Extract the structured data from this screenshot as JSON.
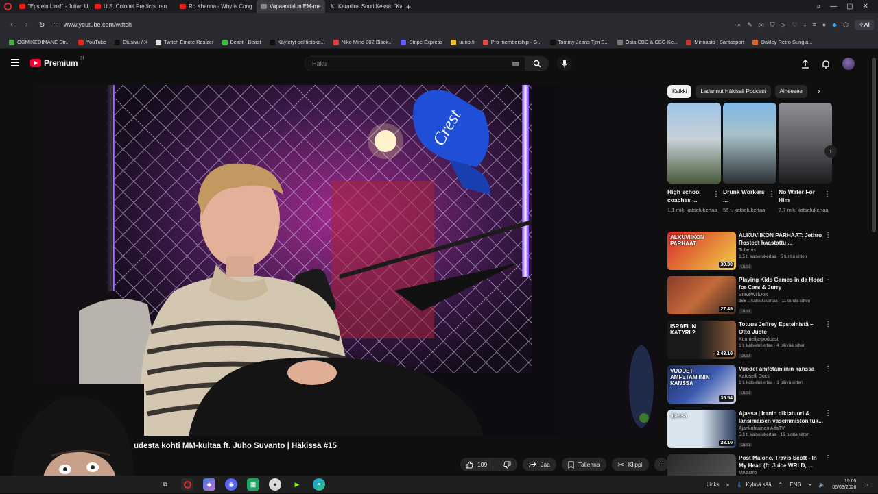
{
  "browser": {
    "tabs": [
      {
        "label": "\"Epstein Link!\" - Julian U..."
      },
      {
        "label": "U.S. Colonel Predicts Iran"
      },
      {
        "label": "Ro Khanna - Why is Cong"
      },
      {
        "label": "Vapaaottelun EM-me"
      },
      {
        "label": "Katariina Souri Kessä: \"Kan"
      }
    ],
    "url": "www.youtube.com/watch",
    "aria_label": "AI",
    "bookmarks": [
      {
        "label": "OGMIKEDIMANE Str...",
        "color": "#3fae3f"
      },
      {
        "label": "YouTube",
        "color": "#e62117"
      },
      {
        "label": "Etusivu / X",
        "color": "#111111"
      },
      {
        "label": "Twitch Emote Resizer",
        "color": "#dddddd"
      },
      {
        "label": "Beast - Beast",
        "color": "#3fbf3f"
      },
      {
        "label": "Käytetyt pelitietoko...",
        "color": "#111111"
      },
      {
        "label": "Nike Mind 002 Black...",
        "color": "#e33b3b"
      },
      {
        "label": "Stripe Express",
        "color": "#635bff"
      },
      {
        "label": "uuno.fi",
        "color": "#f2c12e"
      },
      {
        "label": "Pro membership - G...",
        "color": "#e04c4c"
      },
      {
        "label": "Tommy Jeans Tjm E...",
        "color": "#111111"
      },
      {
        "label": "Osta CBD & CBG Ke...",
        "color": "#777777"
      },
      {
        "label": "Minnasto | Santasport",
        "color": "#c0392b"
      },
      {
        "label": "Oakley Retro Sungla...",
        "color": "#e0672a"
      }
    ]
  },
  "youtube": {
    "brand": "Premium",
    "brand_region": "FI",
    "search_placeholder": "Haku",
    "video_title": "udesta kohti MM-kultaa ft. Juho Suvanto | Häkissä #15",
    "likes": "109",
    "share_label": "Jaa",
    "save_label": "Tallenna",
    "clip_label": "Klippi",
    "chips": [
      {
        "label": "Kaikki",
        "active": true
      },
      {
        "label": "Ladannut Häkissä Podcast",
        "active": false
      },
      {
        "label": "Aiheesee",
        "active": false
      }
    ],
    "shorts": [
      {
        "title": "High school coaches ...",
        "views": "1,1 milj. katselukertaa"
      },
      {
        "title": "Drunk Workers ...",
        "views": "55 t. katselukertaa"
      },
      {
        "title": "No Water For Him",
        "views": "7,7 milj. katselukertaa"
      }
    ],
    "recommendations": [
      {
        "title": "ALKUVIIKON PARHAAT: Jethro Rostedt haastattu ...",
        "channel": "Tubetus",
        "meta": "1,5 t. katselukertaa · 5 tuntia sitten",
        "badge": "Uusi",
        "duration": "30.30",
        "thumb_text": "ALKUVIIKON PARHAAT"
      },
      {
        "title": "Playing Kids Games in da Hood for Cars & Jurry",
        "channel": "SteveWillDoIt",
        "meta": "358 t. katselukertaa · 11 tuntia sitten",
        "badge": "Uusi",
        "duration": "27.49",
        "thumb_text": ""
      },
      {
        "title": "Totuus Jeffrey Epsteinistä – Otto Juote",
        "channel": "Kuuntelija-podcast",
        "meta": "1 t. katselukertaa · 4 päivää sitten",
        "badge": "Uusi",
        "duration": "2.43.10",
        "thumb_text": "ISRAELIN KÄTYRI ?"
      },
      {
        "title": "Vuodet amfetamiinin kanssa",
        "channel": "Karuselli Docs",
        "meta": "1 t. katselukertaa · 1 päivä sitten",
        "badge": "Uusi",
        "duration": "35.54",
        "thumb_text": "VUODET AMFETAMIININ KANSSA"
      },
      {
        "title": "Ajassa | Iranin diktatuuri & länsimaisen vasemmiston tuk...",
        "channel": "Ajankohtainen AlfaTV",
        "meta": "5,6 t. katselukertaa · 19 tuntia sitten",
        "badge": "Uusi",
        "duration": "28.10",
        "thumb_text": "ajassa"
      },
      {
        "title": "Post Malone, Travis Scott - In My Head (ft. Juice WRLD, ...",
        "channel": "MKastro",
        "meta": "",
        "badge": "",
        "duration": "",
        "thumb_text": ""
      }
    ]
  },
  "taskbar": {
    "links_label": "Links",
    "weather": "Kylmä sää",
    "lang": "ENG",
    "time": "19.05",
    "date": "05/03/2026"
  },
  "colors": {
    "yt_red": "#ff0033",
    "accent_purple": "#b35cff"
  }
}
